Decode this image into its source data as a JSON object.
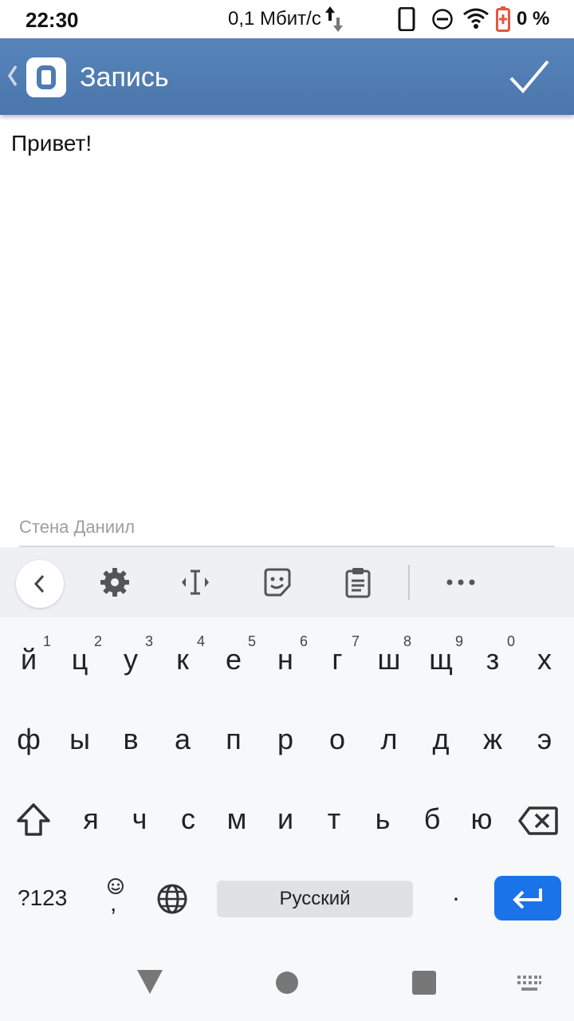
{
  "status_bar": {
    "time": "22:30",
    "network_speed": "0,1 Мбит/с",
    "battery_percent": "0 %",
    "battery_level": 0,
    "icons": [
      "data-arrows-icon",
      "phone-icon",
      "do-not-disturb-icon",
      "wifi-icon",
      "battery-charging-icon"
    ]
  },
  "app_bar": {
    "title": "Запись",
    "back_icon": "chevron-left-icon",
    "logo": "vk-logo",
    "action_icon": "checkmark-icon",
    "background_color": "#5179b0"
  },
  "editor": {
    "text": "Привет!",
    "wall_label": "Стена Даниил"
  },
  "keyboard_toolbar": {
    "icons": [
      "chevron-left-icon",
      "gear-icon",
      "text-cursor-icon",
      "sticker-icon",
      "clipboard-icon",
      "more-icon"
    ]
  },
  "keyboard": {
    "row1": [
      {
        "char": "й",
        "num": "1"
      },
      {
        "char": "ц",
        "num": "2"
      },
      {
        "char": "у",
        "num": "3"
      },
      {
        "char": "к",
        "num": "4"
      },
      {
        "char": "е",
        "num": "5"
      },
      {
        "char": "н",
        "num": "6"
      },
      {
        "char": "г",
        "num": "7"
      },
      {
        "char": "ш",
        "num": "8"
      },
      {
        "char": "щ",
        "num": "9"
      },
      {
        "char": "з",
        "num": "0"
      },
      {
        "char": "х",
        "num": ""
      }
    ],
    "row2": [
      "ф",
      "ы",
      "в",
      "а",
      "п",
      "р",
      "о",
      "л",
      "д",
      "ж",
      "э"
    ],
    "row3": [
      "я",
      "ч",
      "с",
      "м",
      "и",
      "т",
      "ь",
      "б",
      "ю"
    ],
    "symbols_label": "?123",
    "comma": ",",
    "space_label": "Русский",
    "period": ".",
    "enter_color": "#1a73e8"
  },
  "nav_bar": {
    "icons": [
      "nav-back-icon",
      "nav-home-icon",
      "nav-recents-icon",
      "keyboard-switch-icon"
    ]
  }
}
